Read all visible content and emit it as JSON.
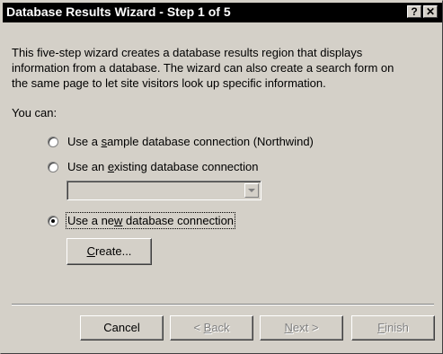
{
  "window": {
    "title": "Database Results Wizard - Step 1 of 5",
    "help_label": "?",
    "close_label": "✕"
  },
  "description": {
    "lines": [
      "This five-step wizard creates a database results region that displays",
      "information from a database. The wizard can also create a search form on",
      "the same page to let site visitors look up specific information."
    ]
  },
  "options": {
    "heading": "You can:",
    "items": [
      {
        "pre": "Use a ",
        "accel": "s",
        "post": "ample database connection (Northwind)",
        "selected": false
      },
      {
        "pre": "Use an ",
        "accel": "e",
        "post": "xisting database connection",
        "selected": false
      },
      {
        "pre": "Use a ne",
        "accel": "w",
        "post": " database connection",
        "selected": true
      }
    ],
    "existing_connection_value": ""
  },
  "create_button": {
    "accel": "C",
    "post": "reate..."
  },
  "footer": {
    "cancel_label": "Cancel",
    "back": {
      "pre": "< ",
      "accel": "B",
      "post": "ack"
    },
    "next": {
      "pre": "",
      "accel": "N",
      "post": "ext >"
    },
    "finish": {
      "pre": "",
      "accel": "F",
      "post": "inish"
    }
  }
}
